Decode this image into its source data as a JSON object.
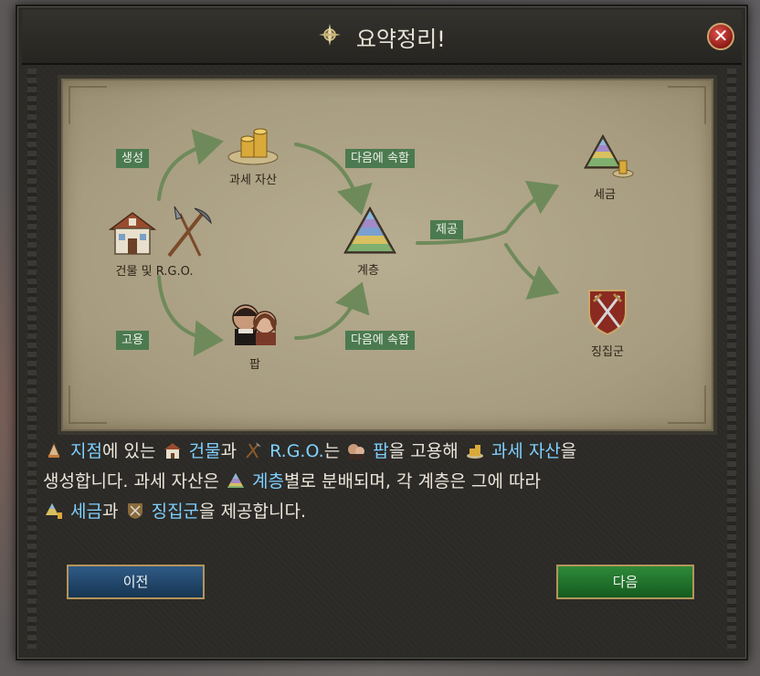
{
  "dialog": {
    "title": "요약정리!"
  },
  "diagram": {
    "tags": {
      "generate": "생성",
      "employ": "고용",
      "belongs_top": "다음에 속함",
      "belongs_bottom": "다음에 속함",
      "provide": "제공"
    },
    "nodes": {
      "buildings": "건물 및 R.G.O.",
      "taxable_wealth": "과세 자산",
      "pops": "팝",
      "strata": "계층",
      "taxes": "세금",
      "levies": "징집군"
    }
  },
  "description": {
    "p1": "지점",
    "t1": "에 있는",
    "p2": "건물",
    "t2": "과",
    "p3": "R.G.O.",
    "t3": "는",
    "p4": "팝",
    "t4": "을 고용해",
    "p5": "과세 자산",
    "t5": "을",
    "t6": "생성합니다. 과세 자산은",
    "p6": "계층",
    "t7": "별로 분배되며, 각 계층은 그에 따라",
    "p7": "세금",
    "t8": "과",
    "p8": "징집군",
    "t9": "을 제공합니다."
  },
  "buttons": {
    "prev": "이전",
    "next": "다음"
  },
  "colors": {
    "highlight": "#7fd0ff",
    "tag_bg": "#4c7a50",
    "prev": "#1f4468",
    "next": "#1e6f29"
  }
}
